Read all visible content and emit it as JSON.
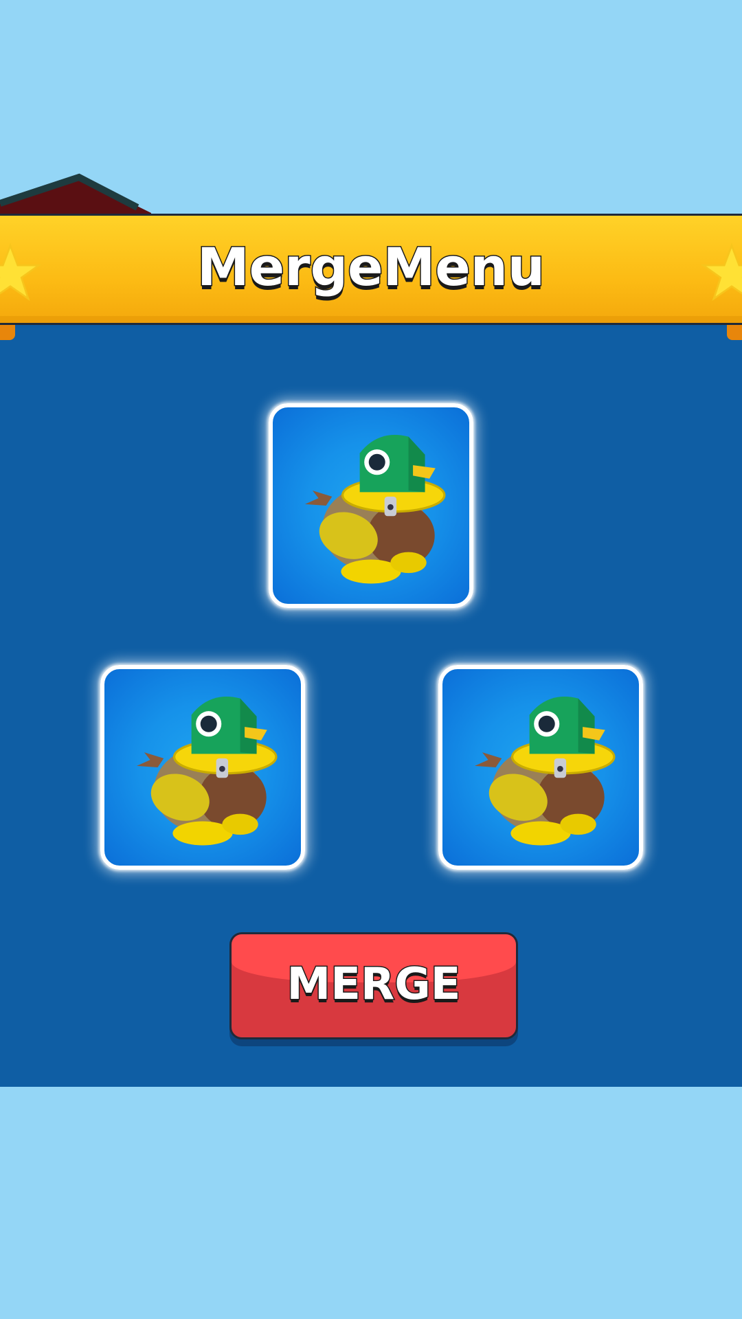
{
  "header": {
    "title": "MergeMenu"
  },
  "merge_slots": [
    {
      "slot": "top",
      "item": "duck-character"
    },
    {
      "slot": "bottom-left",
      "item": "duck-character"
    },
    {
      "slot": "bottom-right",
      "item": "duck-character"
    }
  ],
  "actions": {
    "merge_label": "MERGE"
  },
  "icons": {
    "banner_decoration": "star-icon",
    "slot_item": "duck-character-icon"
  },
  "colors": {
    "sky": "#94d6f6",
    "panel": "#0f5ea4",
    "banner": "#fcbb14",
    "slot": "#1692ea",
    "merge_button": "#ff4b4d"
  }
}
